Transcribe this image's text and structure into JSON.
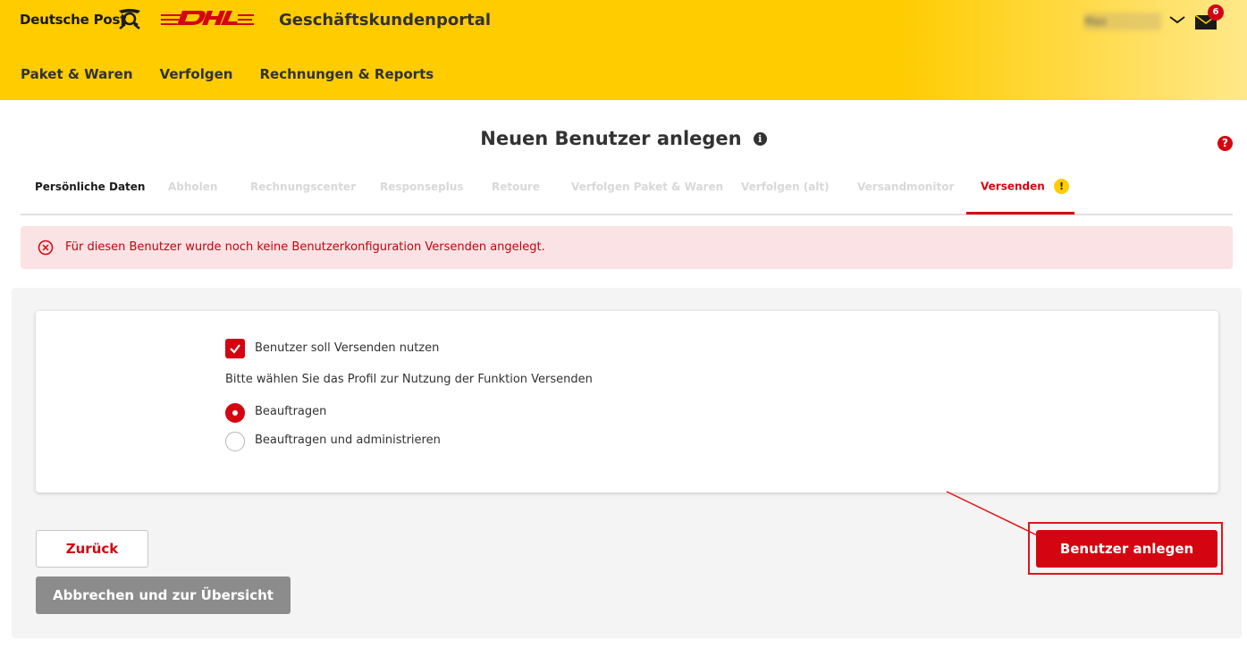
{
  "header": {
    "brand_deutsche_post": "Deutsche Post",
    "portal_title": "Geschäftskundenportal",
    "user_name": "Max Mustermann",
    "mail_count": "6",
    "brand_color": "#ffcc00",
    "accent_color": "#d40511",
    "nav": [
      {
        "label": "Paket & Waren"
      },
      {
        "label": "Verfolgen"
      },
      {
        "label": "Rechnungen & Reports"
      }
    ]
  },
  "page": {
    "title": "Neuen Benutzer anlegen",
    "info_glyph": "i",
    "help_glyph": "?"
  },
  "tabs": [
    {
      "label": "Persönliche Daten",
      "state": "current"
    },
    {
      "label": "Abholen",
      "state": "disabled"
    },
    {
      "label": "Rechnungscenter",
      "state": "disabled"
    },
    {
      "label": "Responseplus",
      "state": "disabled"
    },
    {
      "label": "Retoure",
      "state": "disabled"
    },
    {
      "label": "Verfolgen Paket & Waren",
      "state": "disabled"
    },
    {
      "label": "Verfolgen (alt)",
      "state": "disabled"
    },
    {
      "label": "Versandmonitor",
      "state": "disabled"
    },
    {
      "label": "Versenden",
      "state": "active",
      "warning_glyph": "!"
    }
  ],
  "alert": {
    "text": "Für diesen Benutzer wurde noch keine Benutzerkonfiguration Versenden angelegt."
  },
  "form": {
    "checkbox_label": "Benutzer soll Versenden nutzen",
    "checkbox_checked": true,
    "profile_prompt": "Bitte wählen Sie das Profil zur Nutzung der Funktion Versenden",
    "radios": [
      {
        "label": "Beauftragen",
        "selected": true
      },
      {
        "label": "Beauftragen und administrieren",
        "selected": false
      }
    ]
  },
  "buttons": {
    "back": "Zurück",
    "cancel": "Abbrechen und zur Übersicht",
    "create": "Benutzer anlegen"
  }
}
